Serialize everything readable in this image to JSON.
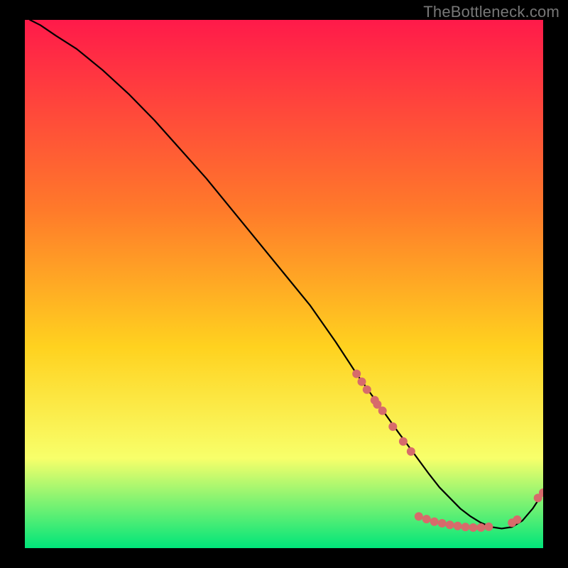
{
  "watermark": "TheBottleneck.com",
  "colors": {
    "gradient_top": "#ff1a4a",
    "gradient_mid1": "#ff7a2a",
    "gradient_mid2": "#ffd21f",
    "gradient_mid3": "#f8ff6a",
    "gradient_bot": "#00e57a",
    "line": "#000000",
    "marker": "#d76b6b",
    "frame": "#000000"
  },
  "chart_data": {
    "type": "line",
    "title": "",
    "xlabel": "",
    "ylabel": "",
    "xlim": [
      0,
      100
    ],
    "ylim": [
      0,
      100
    ],
    "grid": false,
    "legend": false,
    "series": [
      {
        "name": "curve",
        "x": [
          1,
          3,
          6,
          10,
          15,
          20,
          25,
          30,
          35,
          40,
          45,
          50,
          55,
          60,
          64,
          68,
          72,
          75,
          78,
          80,
          82,
          84,
          86,
          88,
          90,
          92,
          94,
          96,
          98,
          100
        ],
        "y": [
          100,
          99,
          97,
          94.5,
          90.5,
          86,
          81,
          75.5,
          70,
          64,
          58,
          52,
          46,
          39,
          33,
          27.5,
          22,
          18,
          14,
          11.5,
          9.5,
          7.5,
          6,
          4.8,
          4,
          3.7,
          4,
          5.2,
          7.5,
          10.5
        ]
      }
    ],
    "markers": [
      {
        "x": 64,
        "y": 33
      },
      {
        "x": 65,
        "y": 31.5
      },
      {
        "x": 66,
        "y": 30
      },
      {
        "x": 67.5,
        "y": 28
      },
      {
        "x": 69,
        "y": 26
      },
      {
        "x": 68,
        "y": 27.2
      },
      {
        "x": 71,
        "y": 23
      },
      {
        "x": 73,
        "y": 20.2
      },
      {
        "x": 74.5,
        "y": 18.3
      },
      {
        "x": 76,
        "y": 6
      },
      {
        "x": 77.5,
        "y": 5.5
      },
      {
        "x": 79,
        "y": 5
      },
      {
        "x": 80.5,
        "y": 4.7
      },
      {
        "x": 82,
        "y": 4.4
      },
      {
        "x": 83.5,
        "y": 4.2
      },
      {
        "x": 85,
        "y": 4
      },
      {
        "x": 86.5,
        "y": 3.9
      },
      {
        "x": 88,
        "y": 3.9
      },
      {
        "x": 89.5,
        "y": 4.05
      },
      {
        "x": 94,
        "y": 4.8
      },
      {
        "x": 95,
        "y": 5.4
      },
      {
        "x": 99,
        "y": 9.5
      },
      {
        "x": 100,
        "y": 10.5
      }
    ]
  }
}
